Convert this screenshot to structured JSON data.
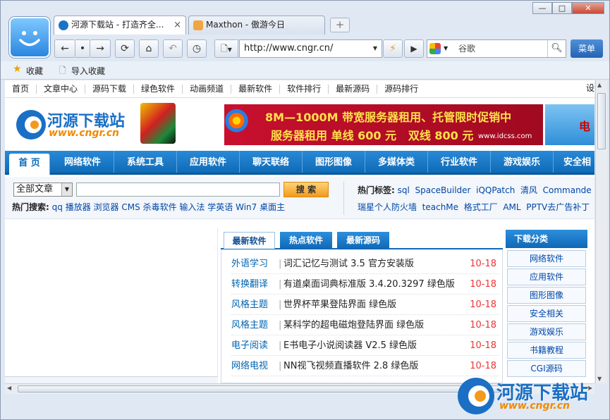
{
  "window": {
    "minimize": "—",
    "restore": "□",
    "close": "✕"
  },
  "tabs": [
    {
      "label": "河源下载站 - 打造齐全...",
      "close": "×"
    },
    {
      "label": "Maxthon - 傲游今日"
    }
  ],
  "new_tab_label": "+",
  "toolbar": {
    "back": "←",
    "dot": "•",
    "forward": "→",
    "refresh": "⟳",
    "home": "⌂",
    "undo": "↶",
    "history": "◷",
    "page_icon": "🗋",
    "address": "http://www.cngr.cn/",
    "go": "▶",
    "search_placeholder": "谷歌",
    "menu": "菜单"
  },
  "favbar": {
    "bookmarks": "收藏",
    "import": "导入收藏"
  },
  "site": {
    "topnav": [
      "首页",
      "文章中心",
      "源码下载",
      "绿色软件",
      "动画频道",
      "最新软件",
      "软件排行",
      "最新源码",
      "源码排行"
    ],
    "topnav_right": "设",
    "logo_cn": "河源下载站",
    "logo_url": "www.cngr.cn",
    "banner_line1": "8M—1000M 带宽服务器租用、托管限时促销中",
    "banner_line2": "服务器租用 单线 600 元   双线 800 元",
    "banner_domain": "www.idcss.com",
    "banner_side": "电",
    "mainnav": [
      "首 页",
      "网络软件",
      "系统工具",
      "应用软件",
      "聊天联络",
      "图形图像",
      "多媒体类",
      "行业软件",
      "游戏娱乐",
      "安全相"
    ],
    "search_select": "全部文章",
    "search_button": "搜 索",
    "hot_search_label": "热门搜索:",
    "hot_search": [
      "qq",
      "播放器",
      "浏览器",
      "CMS",
      "杀毒软件",
      "输入法",
      "学英语",
      "Win7",
      "桌面主"
    ],
    "hot_tags_label": "热门标签:",
    "hot_tags_1": [
      "sql",
      "SpaceBuilder",
      "iQQPatch",
      "清风",
      "Commande"
    ],
    "hot_tags_2": [
      "瑞星个人防火墙",
      "teachMe",
      "格式工厂",
      "AML",
      "PPTV去广告补丁"
    ],
    "list_tabs": [
      "最新软件",
      "热点软件",
      "最新源码"
    ],
    "list": [
      {
        "cat": "外语学习",
        "title": "词汇记忆与测试 3.5 官方安装版",
        "date": "10-18"
      },
      {
        "cat": "转换翻译",
        "title": "有道桌面词典标准版 3.4.20.3297 绿色版",
        "date": "10-18"
      },
      {
        "cat": "风格主题",
        "title": "世界杯苹果登陆界面 绿色版",
        "date": "10-18"
      },
      {
        "cat": "风格主题",
        "title": "某科学的超电磁炮登陆界面 绿色版",
        "date": "10-18"
      },
      {
        "cat": "电子阅读",
        "title": "E书电子小说阅读器 V2.5 绿色版",
        "date": "10-18"
      },
      {
        "cat": "网络电视",
        "title": "NN视飞视频直播软件 2.8 绿色版",
        "date": "10-18"
      }
    ],
    "download_cat_header": "下载分类",
    "categories": [
      "网络软件",
      "应用软件",
      "图形图像",
      "安全相关",
      "游戏娱乐",
      "书籍教程",
      "CGI源码"
    ]
  },
  "watermark": {
    "cn": "河源下载站",
    "url": "www.cngr.cn"
  },
  "colors": {
    "accent": "#1068b6",
    "date": "#e33333",
    "link": "#0047a8"
  }
}
